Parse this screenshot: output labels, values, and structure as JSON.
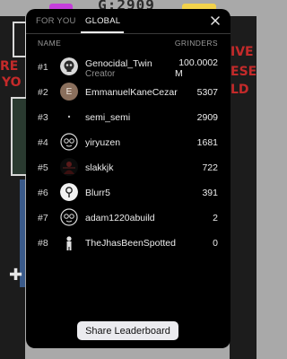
{
  "background": {
    "counter": "G:2909",
    "red_left_1": "RE",
    "red_left_2": "YO",
    "red_right_1": "IVE",
    "red_right_2": "ESE",
    "red_right_3": "LD"
  },
  "tabs": [
    {
      "label": "FOR YOU",
      "active": false
    },
    {
      "label": "GLOBAL",
      "active": true
    }
  ],
  "columns": {
    "name": "NAME",
    "score": "GRINDERS"
  },
  "leaderboard": [
    {
      "rank": "#1",
      "name": "Genocidal_Twin",
      "subtitle": "Creator",
      "score_line1": "100.0002",
      "score_line2": "M",
      "avatar": "skull-icon"
    },
    {
      "rank": "#2",
      "name": "EmmanuelKaneCezar",
      "score": "5307",
      "avatar": "letter-avatar",
      "initial": "E",
      "avatar_color": "#8a6f5c"
    },
    {
      "rank": "#3",
      "name": "semi_semi",
      "score": "2909",
      "avatar": "dot-avatar"
    },
    {
      "rank": "#4",
      "name": "yiryuzen",
      "score": "1681",
      "avatar": "mask-icon"
    },
    {
      "rank": "#5",
      "name": "slakkjk",
      "score": "722",
      "avatar": "dark-figure-icon"
    },
    {
      "rank": "#6",
      "name": "Blurr5",
      "score": "391",
      "avatar": "pin-icon"
    },
    {
      "rank": "#7",
      "name": "adam1220abuild",
      "score": "2",
      "avatar": "mask-icon"
    },
    {
      "rank": "#8",
      "name": "TheJhasBeenSpotted",
      "score": "0",
      "avatar": "figure-icon"
    }
  ],
  "share_button": "Share Leaderboard",
  "colors": {
    "modal_bg": "#000000",
    "button_bg": "#ebebef",
    "text": "#ececec",
    "muted": "#8f8f8f"
  }
}
